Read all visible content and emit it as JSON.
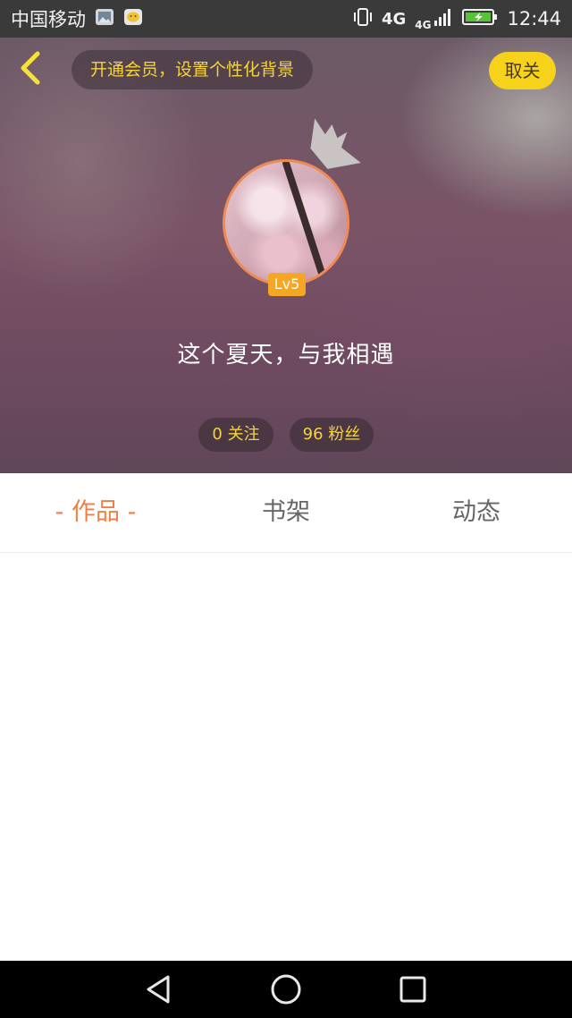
{
  "status_bar": {
    "carrier": "中国移动",
    "network_1": "4G",
    "network_2": "4G",
    "time": "12:44",
    "icons": [
      "gallery-icon",
      "wechat-icon",
      "vibrate-icon",
      "signal-icon",
      "battery-charging-icon"
    ]
  },
  "header": {
    "vip_prompt": "开通会员，设置个性化背景",
    "unfollow_label": "取关",
    "level": "Lv5",
    "username": "这个夏天，与我相遇",
    "following": "0 关注",
    "fans": "96 粉丝"
  },
  "tabs": [
    {
      "label": "- 作品 -",
      "active": true
    },
    {
      "label": "书架",
      "active": false
    },
    {
      "label": "动态",
      "active": false
    }
  ],
  "colors": {
    "accent_yellow": "#f7d21a",
    "active_tab": "#f07f45",
    "avatar_border": "#f08a55",
    "level_badge": "#f5a623"
  },
  "nav_bar": {
    "icons": [
      "back-triangle-icon",
      "home-circle-icon",
      "recents-square-icon"
    ]
  }
}
